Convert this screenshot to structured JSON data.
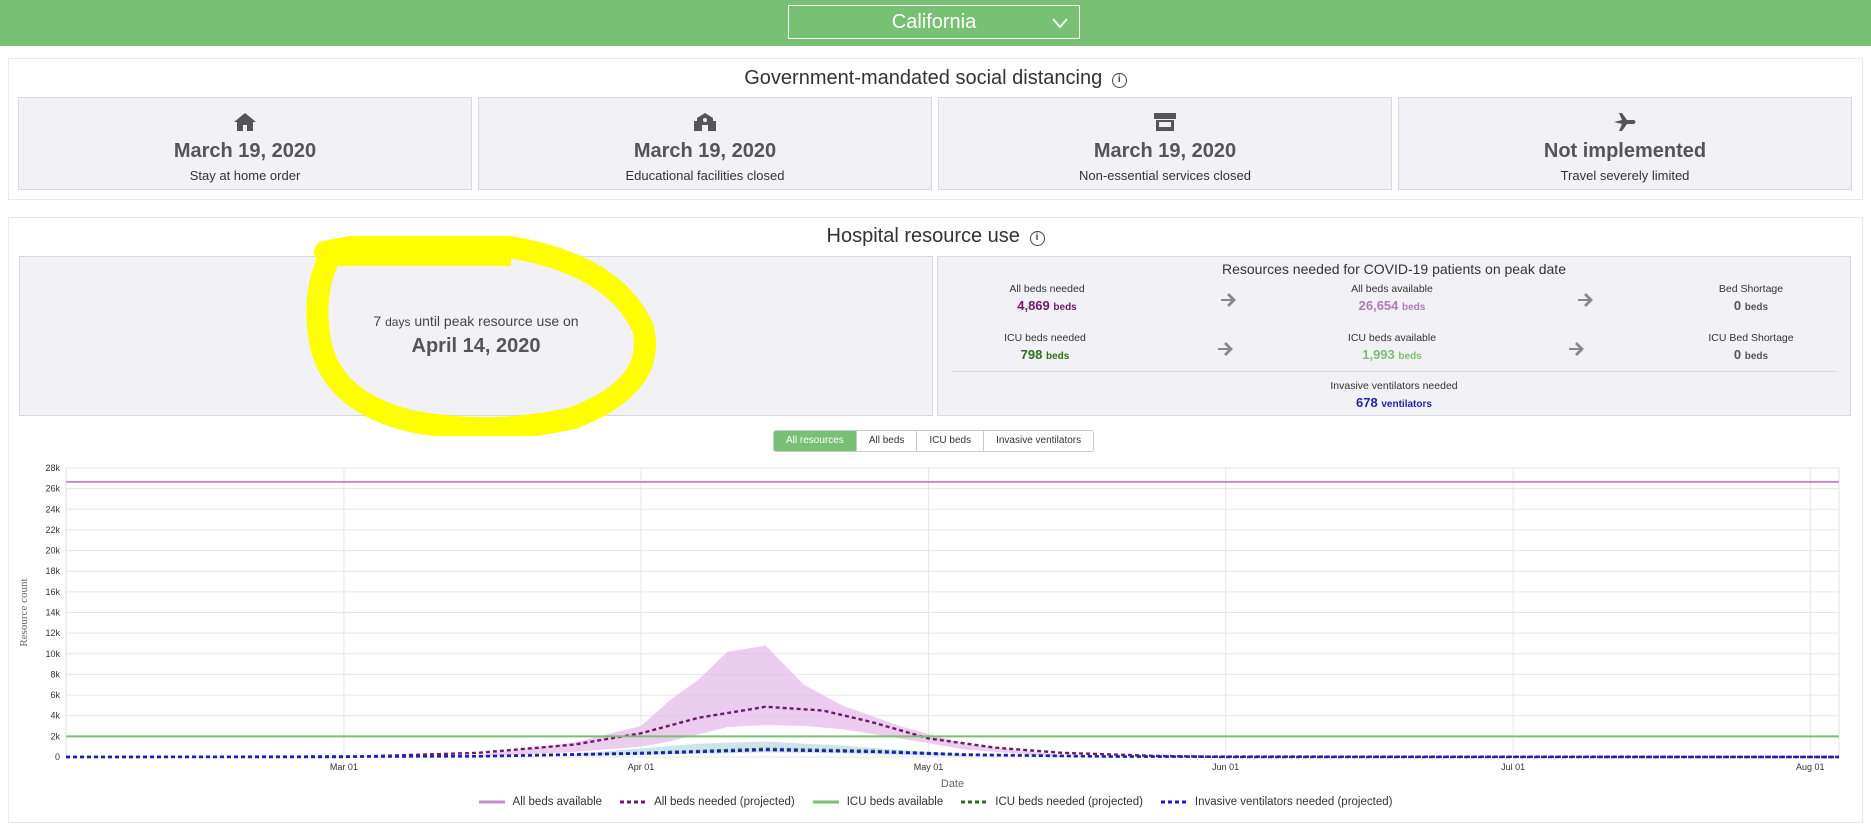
{
  "state_selector": {
    "value": "California"
  },
  "social_distancing": {
    "title": "Government-mandated social distancing",
    "cards": [
      {
        "icon": "home-icon",
        "date": "March 19, 2020",
        "label": "Stay at home order"
      },
      {
        "icon": "school-icon",
        "date": "March 19, 2020",
        "label": "Educational facilities closed"
      },
      {
        "icon": "store-icon",
        "date": "March 19, 2020",
        "label": "Non-essential services closed"
      },
      {
        "icon": "airplane-icon",
        "date": "Not implemented",
        "label": "Travel severely limited"
      }
    ]
  },
  "hospital": {
    "title": "Hospital resource use",
    "peak": {
      "days": "7",
      "days_unit": "days",
      "text": "until peak resource use on",
      "date": "April 14, 2020"
    },
    "resources": {
      "title": "Resources needed for COVID-19 patients on peak date",
      "all_beds_needed": {
        "label": "All beds needed",
        "value": "4,869",
        "unit": "beds",
        "color": "#6a1b6a"
      },
      "all_beds_available": {
        "label": "All beds available",
        "value": "26,654",
        "unit": "beds",
        "color": "#b07ab8"
      },
      "bed_shortage": {
        "label": "Bed Shortage",
        "value": "0",
        "unit": "beds",
        "color": "#555555"
      },
      "icu_needed": {
        "label": "ICU beds needed",
        "value": "798",
        "unit": "beds",
        "color": "#2e6b1e"
      },
      "icu_available": {
        "label": "ICU beds available",
        "value": "1,993",
        "unit": "beds",
        "color": "#7bbf72"
      },
      "icu_shortage": {
        "label": "ICU Bed Shortage",
        "value": "0",
        "unit": "beds",
        "color": "#555555"
      },
      "ventilators": {
        "label": "Invasive ventilators needed",
        "value": "678",
        "unit": "ventilators",
        "color": "#2222aa"
      }
    },
    "toggles": [
      "All resources",
      "All beds",
      "ICU beds",
      "Invasive ventilators"
    ]
  },
  "chart_data": {
    "type": "line",
    "xlabel": "Date",
    "ylabel": "Resource count",
    "ylim": [
      0,
      28000
    ],
    "xlim": [
      "2020-02-01",
      "2020-08-04"
    ],
    "y_ticks": [
      "0",
      "2k",
      "4k",
      "6k",
      "8k",
      "10k",
      "12k",
      "14k",
      "16k",
      "18k",
      "20k",
      "22k",
      "24k",
      "26k",
      "28k"
    ],
    "x_ticks": [
      {
        "date": "2020-03-01",
        "label": "Mar 01"
      },
      {
        "date": "2020-04-01",
        "label": "Apr 01"
      },
      {
        "date": "2020-05-01",
        "label": "May 01"
      },
      {
        "date": "2020-06-01",
        "label": "Jun 01"
      },
      {
        "date": "2020-07-01",
        "label": "Jul 01"
      },
      {
        "date": "2020-08-01",
        "label": "Aug 01"
      }
    ],
    "grid": true,
    "legend_position": "bottom",
    "series": [
      {
        "name": "All beds available",
        "color": "#c58ccd",
        "style": "solid",
        "x": [
          "2020-02-01",
          "2020-08-04"
        ],
        "y": [
          26654,
          26654
        ]
      },
      {
        "name": "All beds needed (projected)",
        "color": "#6a1b6a",
        "style": "dashed",
        "x": [
          "2020-02-01",
          "2020-03-01",
          "2020-03-15",
          "2020-03-25",
          "2020-04-01",
          "2020-04-07",
          "2020-04-14",
          "2020-04-20",
          "2020-04-25",
          "2020-05-01",
          "2020-05-08",
          "2020-05-15",
          "2020-05-25",
          "2020-06-01",
          "2020-08-04"
        ],
        "y": [
          0,
          0,
          400,
          1200,
          2300,
          3800,
          4869,
          4500,
          3400,
          1800,
          900,
          400,
          100,
          0,
          0
        ]
      },
      {
        "name": "ICU beds available",
        "color": "#7bbf72",
        "style": "solid",
        "x": [
          "2020-02-01",
          "2020-08-04"
        ],
        "y": [
          1993,
          1993
        ]
      },
      {
        "name": "ICU beds needed (projected)",
        "color": "#2e6b1e",
        "style": "dashed",
        "x": [
          "2020-02-01",
          "2020-03-15",
          "2020-04-01",
          "2020-04-14",
          "2020-04-25",
          "2020-05-05",
          "2020-05-20",
          "2020-08-04"
        ],
        "y": [
          0,
          80,
          400,
          798,
          600,
          250,
          50,
          0
        ]
      },
      {
        "name": "Invasive ventilators needed (projected)",
        "color": "#1a1acc",
        "style": "dashed",
        "x": [
          "2020-02-01",
          "2020-03-15",
          "2020-04-01",
          "2020-04-14",
          "2020-04-25",
          "2020-05-05",
          "2020-05-20",
          "2020-08-04"
        ],
        "y": [
          0,
          60,
          330,
          678,
          500,
          200,
          40,
          0
        ]
      }
    ],
    "bands": [
      {
        "series": "All beds needed (projected)",
        "color": "#e6b8e8",
        "x": [
          "2020-03-15",
          "2020-03-25",
          "2020-04-01",
          "2020-04-04",
          "2020-04-07",
          "2020-04-10",
          "2020-04-14",
          "2020-04-18",
          "2020-04-22",
          "2020-04-28",
          "2020-05-05",
          "2020-05-15"
        ],
        "upper": [
          200,
          1400,
          3000,
          5500,
          7500,
          10200,
          10800,
          7000,
          5000,
          3000,
          1200,
          200
        ],
        "lower": [
          0,
          500,
          1000,
          1500,
          2200,
          2900,
          3100,
          3000,
          2700,
          1800,
          700,
          0
        ]
      },
      {
        "series": "ICU beds needed (projected)",
        "color": "#b8d8e8",
        "x": [
          "2020-03-25",
          "2020-04-07",
          "2020-04-14",
          "2020-04-22",
          "2020-05-05"
        ],
        "upper": [
          300,
          1300,
          1500,
          1100,
          200
        ],
        "lower": [
          100,
          300,
          450,
          350,
          50
        ]
      }
    ]
  }
}
